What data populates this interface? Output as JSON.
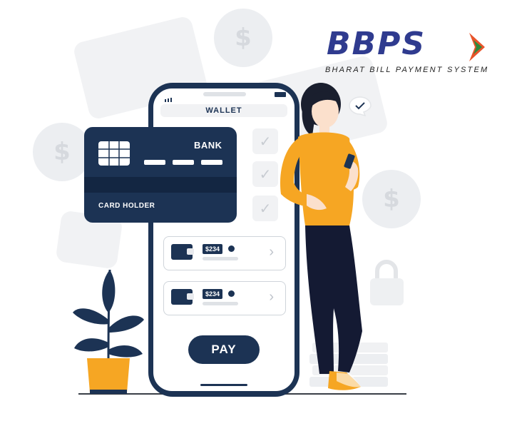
{
  "logo": {
    "text": "BBPS",
    "subtitle": "BHARAT BILL PAYMENT SYSTEM",
    "brand_color": "#2f3b8f",
    "accent_colors": [
      "#e8542a",
      "#2d8a3e"
    ]
  },
  "phone": {
    "header_title": "WALLET",
    "pay_label": "PAY",
    "transactions": [
      {
        "amount": "$234"
      },
      {
        "amount": "$234"
      }
    ]
  },
  "card": {
    "bank_label": "BANK",
    "holder_label": "CARD HOLDER"
  },
  "colors": {
    "navy": "#1c3354",
    "shirt": "#f6a623",
    "plant_pot": "#f6a623",
    "background_shapes": "#f1f2f4"
  },
  "icons": [
    "dollar-coin-icon",
    "check-icon",
    "wallet-icon",
    "chevron-right-icon",
    "lock-icon",
    "chat-check-icon"
  ]
}
